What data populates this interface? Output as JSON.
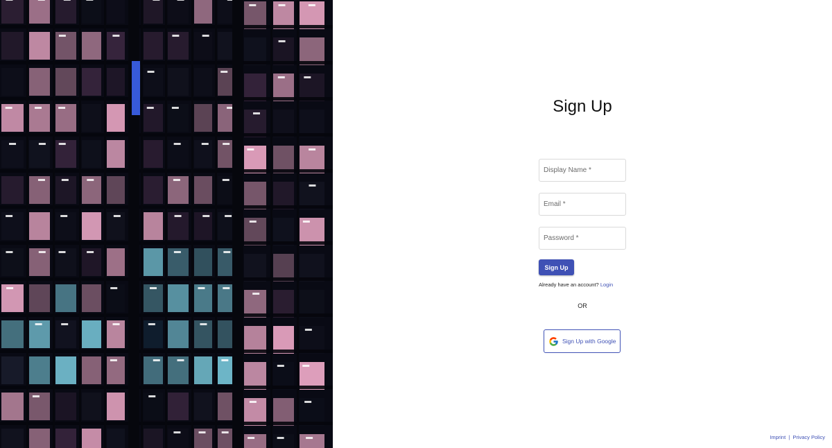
{
  "page": {
    "title": "Sign Up"
  },
  "hero": {
    "image_subject": "office building facade at night with lit windows"
  },
  "form": {
    "display_name_placeholder": "Display Name *",
    "email_placeholder": "Email *",
    "password_placeholder": "Password *",
    "display_name_value": "",
    "email_value": "",
    "password_value": "",
    "submit_label": "Sign Up",
    "already_text": "Already have an account?",
    "login_link": "Login"
  },
  "divider": {
    "or_text": "OR"
  },
  "google": {
    "label": "Sign Up with Google",
    "icon": "google-icon"
  },
  "footer": {
    "imprint": "Imprint",
    "separator": "|",
    "privacy": "Privacy Policy"
  },
  "colors": {
    "accent": "#3f51b5",
    "hero_bg": "#0b0c16",
    "window_pink": "#e9a6c4",
    "window_cyan": "#7fd3e6"
  }
}
